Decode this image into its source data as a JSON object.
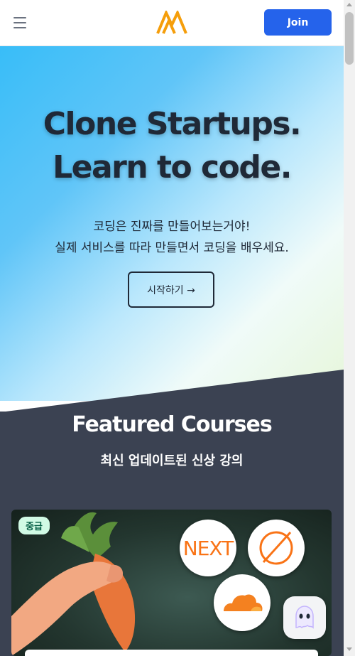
{
  "navbar": {
    "menu_icon": "hamburger-menu-icon",
    "logo_icon": "nomad-m-logo-icon",
    "join_label": "Join",
    "colors": {
      "join_bg": "#2563eb",
      "logo": "#f59e0b"
    }
  },
  "hero": {
    "title_line1": "Clone Startups.",
    "title_line2": "Learn to code.",
    "subtitle_line1": "코딩은 진짜를 만들어보는거야!",
    "subtitle_line2": "실제 서비스를 따라 만들면서 코딩을 배우세요.",
    "cta_label": "시작하기 →"
  },
  "featured": {
    "title": "Featured Courses",
    "subtitle": "최신 업데이트된 신상 강의",
    "course": {
      "level_badge": "중급",
      "next_logo_text": "NEXT",
      "icons": [
        "carrot-in-hand-icon",
        "nextjs-logo-icon",
        "orange-circle-logo-icon",
        "cloudflare-logo-icon"
      ]
    }
  },
  "chat_widget": {
    "icon": "ghost-chat-icon"
  }
}
